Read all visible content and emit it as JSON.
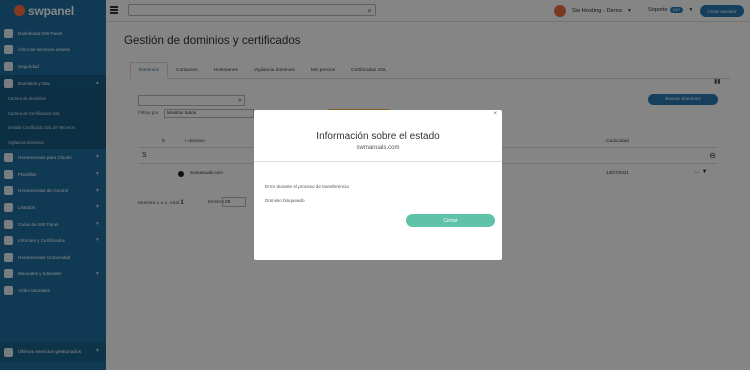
{
  "app": {
    "logo": "swpanel"
  },
  "topbar": {
    "search_placeholder": "",
    "account_name": "Sw Hosting - Demo",
    "support_label": "Soporte",
    "support_badge": "24/7",
    "cta_label": "Crear servidor"
  },
  "sidebar": {
    "items": [
      {
        "label": "Dashboard SW Panel"
      },
      {
        "label": "Árbol de servicios activos"
      },
      {
        "label": "Seguridad"
      },
      {
        "label": "Dominios y SSL"
      },
      {
        "label": "Herramientas para Clouds"
      },
      {
        "label": "Plantillas"
      },
      {
        "label": "Herramientas de Control"
      },
      {
        "label": "Listados"
      },
      {
        "label": "Guías de SW Panel"
      },
      {
        "label": "Informes y Certificados"
      },
      {
        "label": "Herramientas Comunidad"
      },
      {
        "label": "Manuales y tutoriales"
      },
      {
        "label": "Vídeo tutoriales"
      }
    ],
    "subitems": [
      {
        "label": "Cartera de dominios"
      },
      {
        "label": "Cartera de Certificados SSL"
      },
      {
        "label": "Instalar Certificado SSL de Terceros"
      },
      {
        "label": "Vigilancia dominios"
      }
    ],
    "bottom_label": "Últimos servicios gestionados"
  },
  "main": {
    "title": "Gestión de dominios y certificados",
    "tabs": [
      {
        "label": "Dominios"
      },
      {
        "label": "Contactos"
      },
      {
        "label": "Hostnames"
      },
      {
        "label": "Vigilancia dominios"
      },
      {
        "label": "Mis precios"
      },
      {
        "label": "Certificados SSL"
      }
    ],
    "search_button": "Buscar dominios",
    "filter_label": "Filtrar por",
    "filter_value": "Mostrar todos",
    "table": {
      "col_state": "E",
      "col_domain": "+ dominio",
      "col_expiry": "Caducidad",
      "letter": "S",
      "row_domain": "swmanuals.com",
      "row_expiry": "13/07/2021"
    },
    "pager_text": "Muestra 1 a 1, total",
    "pager_total": "1",
    "perpage_label": "Mostrar",
    "perpage_value": "25"
  },
  "modal": {
    "title": "Información sobre el estado",
    "subtitle": "swmanuals.com",
    "line1": "Error durante el proceso de transferencia",
    "line2": "Dominio bloqueado",
    "close_button": "Cerrar",
    "close_icon": "×"
  }
}
